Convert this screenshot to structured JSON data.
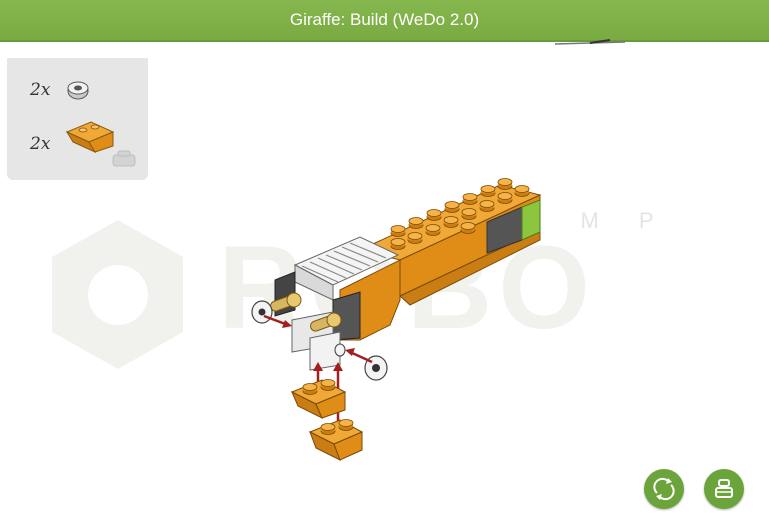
{
  "window": {
    "title": "Giraffe: Build (WeDo 2.0)"
  },
  "parts_panel": {
    "items": [
      {
        "quantity": "2x",
        "part": "white-technic-bushing"
      },
      {
        "quantity": "2x",
        "part": "orange-inverted-slope-brick"
      }
    ]
  },
  "watermark": {
    "text": "ROBO",
    "subtext": "CAMP"
  },
  "controls": {
    "rotate_icon": "rotate-icon",
    "parts_icon": "parts-bin-icon"
  },
  "colors": {
    "accent": "#7aab43",
    "model_orange": "#e8961c",
    "button_green": "#6aa43a"
  }
}
